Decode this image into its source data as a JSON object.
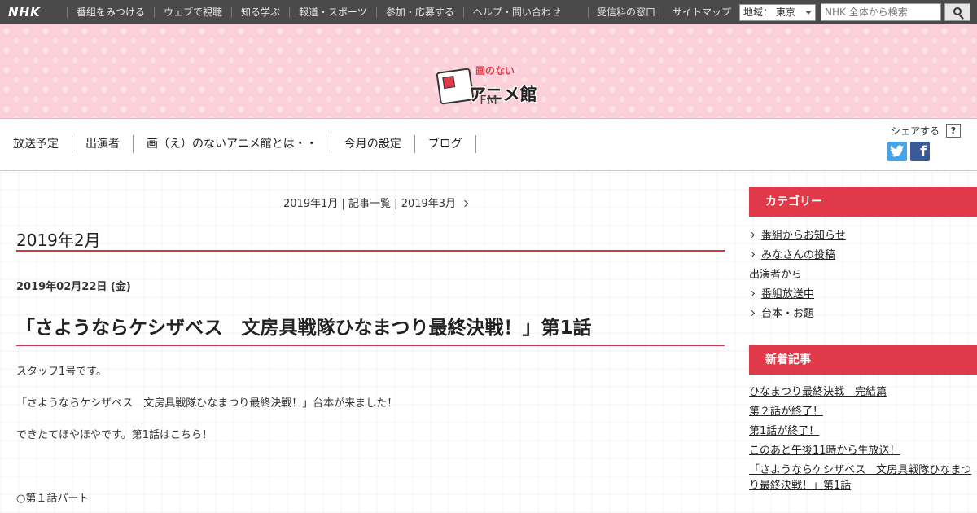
{
  "topbar": {
    "logo": "NHK",
    "nav": [
      "番組をみつける",
      "ウェブで視聴",
      "知る学ぶ",
      "報道・スポーツ",
      "参加・応募する",
      "ヘルプ・問い合わせ"
    ],
    "right_links": [
      "受信料の窓口",
      "サイトマップ"
    ],
    "region": "地域：  東京",
    "search_placeholder": "NHK 全体から検索"
  },
  "banner": {
    "logo_sub": "画のない",
    "logo_title": "アニメ館",
    "channel": "FM"
  },
  "program_nav": {
    "items": [
      "放送予定",
      "出演者",
      "画（え）のないアニメ館とは・・",
      "今月の設定",
      "ブログ"
    ],
    "share_label": "シェアする",
    "help": "?",
    "facebook_glyph": "f"
  },
  "pager": {
    "prev": "2019年1月",
    "sep1": " | ",
    "index": "記事一覧",
    "sep2": " | ",
    "next": "2019年3月"
  },
  "main": {
    "month_heading": "2019年2月",
    "date": "2019年02月22日 (金)",
    "entry_title": "「さようならケシザベス　文房具戦隊ひなまつり最終決戦！」第1話",
    "paragraphs": [
      "スタッフ1号です。",
      "「さようならケシザベス　文房具戦隊ひなまつり最終決戦！」台本が来ました！",
      "できたてほやほやです。第1話はこちら！",
      "○第１話パート"
    ]
  },
  "sidebar": {
    "category_heading": "カテゴリー",
    "categories": [
      {
        "label": "番組からお知らせ",
        "link": true
      },
      {
        "label": "みなさんの投稿",
        "link": true
      },
      {
        "label": "出演者から",
        "link": false
      },
      {
        "label": "番組放送中",
        "link": true
      },
      {
        "label": "台本・お題",
        "link": true
      }
    ],
    "recent_heading": "新着記事",
    "recent": [
      "ひなまつり最終決戦　完結篇",
      "第２話が終了！",
      "第1話が終了！",
      "このあと午後11時から生放送！",
      "「さようならケシザベス　文房具戦隊ひなまつ",
      "り最終決戦！」第1話"
    ]
  },
  "colors": {
    "accent": "#e03a4a",
    "topbar": "#4a4a4a",
    "banner": "#fbd0d8",
    "twitter": "#45a3e8",
    "facebook": "#3b5b98"
  }
}
